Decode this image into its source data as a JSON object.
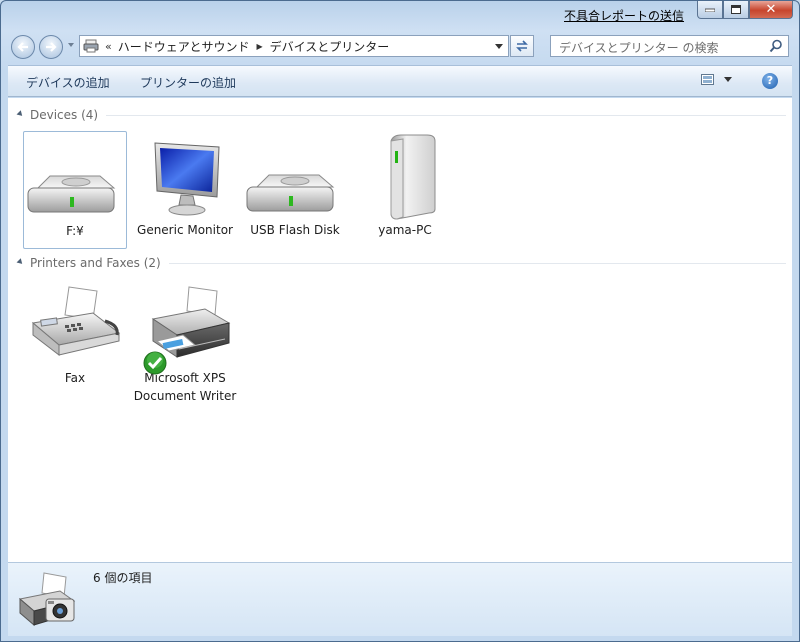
{
  "titlebar": {
    "feedback_link": "不具合レポートの送信"
  },
  "address": {
    "overflow": "«",
    "crumbs": [
      "ハードウェアとサウンド",
      "デバイスとプリンター"
    ]
  },
  "search": {
    "placeholder": "デバイスとプリンター の検索"
  },
  "commands": {
    "add_device": "デバイスの追加",
    "add_printer": "プリンターの追加"
  },
  "groups": {
    "devices": {
      "label": "Devices (4)"
    },
    "printers": {
      "label": "Printers and Faxes (2)"
    }
  },
  "devices": [
    {
      "label": "F:¥",
      "icon": "drive-icon",
      "selected": true
    },
    {
      "label": "Generic Monitor",
      "icon": "monitor-icon"
    },
    {
      "label": "USB Flash Disk",
      "icon": "drive-icon"
    },
    {
      "label": "yama-PC",
      "icon": "computer-tower-icon"
    }
  ],
  "printers": [
    {
      "label": "Fax",
      "icon": "fax-icon"
    },
    {
      "label": "Microsoft XPS Document Writer",
      "icon": "printer-icon",
      "default": true
    }
  ],
  "details": {
    "count_text": "6 個の項目"
  },
  "colors": {
    "accent": "#1e395b",
    "selection_border": "#9cbad8",
    "default_check": "#2c9a2a"
  }
}
